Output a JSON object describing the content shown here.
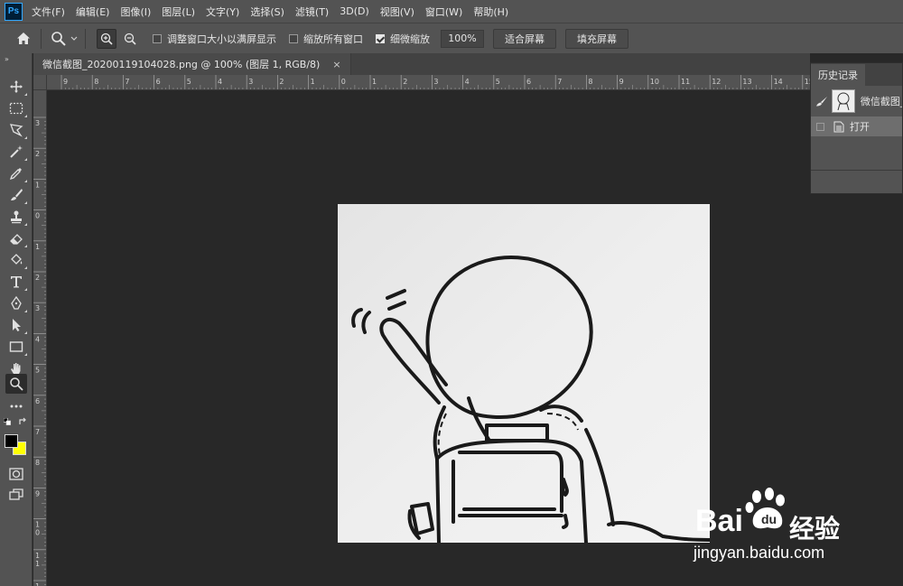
{
  "app": {
    "logo_text": "Ps"
  },
  "menu": [
    "文件(F)",
    "编辑(E)",
    "图像(I)",
    "图层(L)",
    "文字(Y)",
    "选择(S)",
    "滤镜(T)",
    "3D(D)",
    "视图(V)",
    "窗口(W)",
    "帮助(H)"
  ],
  "options": {
    "resize_windows_label": "调整窗口大小以满屏显示",
    "resize_windows_checked": false,
    "zoom_all_windows_label": "缩放所有窗口",
    "zoom_all_windows_checked": false,
    "scrubby_zoom_label": "细微缩放",
    "scrubby_zoom_checked": true,
    "zoom_value": "100%",
    "fit_screen_label": "适合屏幕",
    "fill_screen_label": "填充屏幕"
  },
  "document": {
    "tab_title": "微信截图_20200119104028.png @ 100% (图层 1, RGB/8)",
    "close_glyph": "×"
  },
  "rulers": {
    "top_labels": [
      "9",
      "8",
      "7",
      "6",
      "5",
      "4",
      "3",
      "2",
      "1",
      "0",
      "1",
      "2",
      "3",
      "4",
      "5",
      "6",
      "7",
      "8",
      "9",
      "10",
      "11",
      "12",
      "13",
      "14",
      "15"
    ],
    "left_labels": [
      "3",
      "2",
      "1",
      "0",
      "1",
      "2",
      "3",
      "4",
      "5",
      "6",
      "7",
      "8",
      "9",
      "1 0",
      "1 1",
      "1 2"
    ]
  },
  "colors": {
    "foreground": "#000000",
    "background": "#ffff00",
    "accent": "#31a8ff"
  },
  "history": {
    "tab_label": "历史记录",
    "snapshot_label": "微信截图_",
    "states": [
      {
        "label": "打开",
        "icon": "document-icon"
      }
    ]
  },
  "watermark": {
    "brand": "Bai",
    "brand_suffix": "经验",
    "url": "jingyan.baidu.com"
  },
  "tools": [
    "move-icon",
    "marquee-icon",
    "lasso-icon",
    "magic-wand-icon",
    "eyedropper-icon",
    "brush-icon",
    "stamp-icon",
    "eraser-icon",
    "fill-icon",
    "type-icon",
    "pen-icon",
    "path-select-icon",
    "rectangle-icon",
    "hand-icon",
    "zoom-icon",
    "more-tools-icon"
  ]
}
